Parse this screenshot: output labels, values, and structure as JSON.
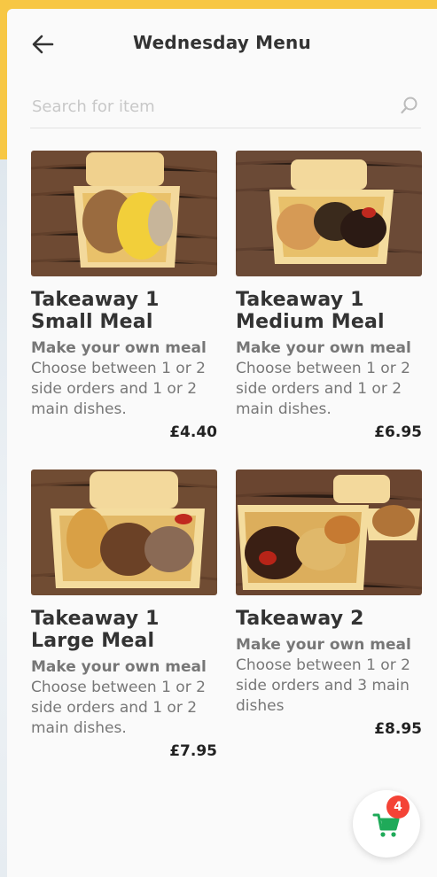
{
  "header": {
    "title": "Wednesday Menu"
  },
  "search": {
    "placeholder": "Search for item"
  },
  "items": [
    {
      "name": "Takeaway 1 Small Meal",
      "subtitle": "Make your own meal",
      "description": "Choose between 1 or 2 side orders and 1 or 2 main dishes.",
      "price": "£4.40"
    },
    {
      "name": "Takeaway 1 Medium Meal",
      "subtitle": "Make your own meal",
      "description": "Choose between 1 or 2 side orders and 1 or 2 main dishes.",
      "price": "£6.95"
    },
    {
      "name": "Takeaway 1 Large Meal",
      "subtitle": "Make your own meal",
      "description": "Choose between 1 or 2 side orders and 1 or 2 main dishes.",
      "price": "£7.95"
    },
    {
      "name": "Takeaway 2",
      "subtitle": "Make your own meal",
      "description": "Choose between 1 or 2 side orders and 3 main dishes",
      "price": "£8.95"
    }
  ],
  "cart": {
    "count": "4",
    "icon": "cart-icon",
    "accent": "#1faa59",
    "badge_color": "#f44336"
  }
}
